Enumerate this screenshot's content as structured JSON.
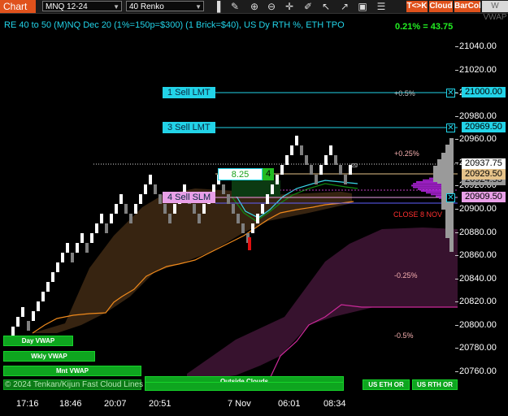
{
  "toolbar": {
    "chart_tab": "Chart",
    "instrument": "MNQ 12-24",
    "bar_type": "40 Renko",
    "icons": [
      "bar-style-icon",
      "drawing-tools-icon",
      "zoom-in-icon",
      "zoom-out-icon",
      "crosshair-icon",
      "pencil-icon",
      "cursor-arrow-icon",
      "cursor-alt-icon",
      "screenshot-icon",
      "properties-icon"
    ],
    "t_k_label": "T<>K",
    "cloud_label": "Cloud",
    "barcol_label": "BarCol",
    "vwap_label": "W VWAP"
  },
  "chart_title": "RE 40 to 50 (M)NQ Dec 20 (1%=150p=$300) (1 Brick=$40), US Dy RTH %, ETH TPO",
  "performance": "0.21% = 43.75",
  "price_axis": {
    "ticks": [
      "21040.00",
      "21020.00",
      "21000.00",
      "20980.00",
      "20960.00",
      "20940.00",
      "20920.00",
      "20900.00",
      "20880.00",
      "20860.00",
      "20840.00",
      "20820.00",
      "20800.00",
      "20780.00",
      "20760.00"
    ],
    "tags": {
      "sell_lmt_1": "21000.00",
      "sell_lmt_2": "20969.50",
      "last": "20937.75",
      "current": "20929.50",
      "hidden": "20924.53",
      "sell_slm": "20909.50"
    }
  },
  "time_axis": [
    "17:16",
    "18:46",
    "20:07",
    "20:51",
    "7 Nov",
    "06:01",
    "08:34"
  ],
  "orders": {
    "sell_lmt_1": "1 Sell LMT",
    "sell_lmt_2": "3 Sell LMT",
    "sell_slm": "4 Sell SLM"
  },
  "position": {
    "price": "8.25",
    "qty": "4"
  },
  "levels": {
    "p05": "+0.5%",
    "p025": "+0.25%",
    "m025": "-0.25%",
    "m05": "-0.5%",
    "close_note": "CLOSE 8 NOV"
  },
  "bars": {
    "day_vwap": "Day VWAP",
    "wkly_vwap": "Wkly VWAP",
    "mnt_vwap": "Mnt VWAP",
    "outside_clouds": "Outside Clouds",
    "us_eth_or": "US ETH OR",
    "us_rth_or": "US RTH OR"
  },
  "watermark": "© 2024 Tenkan/Kijun Fast Cloud Lines",
  "colors": {
    "accent_cyan": "#22d3e8",
    "bull_brick": "#ffffff",
    "bear_brick": "#7f7f7f",
    "cloud_brown": "#3a2612",
    "cloud_purple": "#3a1330",
    "tpo_purple": "#a020c8",
    "vwap_green": "#0ea51f",
    "sell_slm_pink": "#e9a0e8",
    "price_tan": "#e6c38a"
  }
}
